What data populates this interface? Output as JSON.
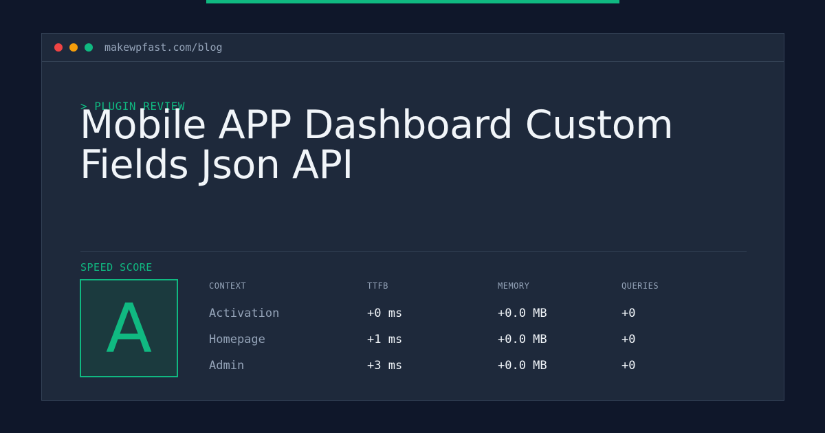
{
  "window": {
    "url": "makewpfast.com/blog"
  },
  "hero": {
    "eyebrow": "> PLUGIN REVIEW",
    "title": "Mobile APP Dashboard Custom Fields Json API"
  },
  "score": {
    "label": "SPEED SCORE",
    "grade": "A"
  },
  "table": {
    "headers": [
      "CONTEXT",
      "TTFB",
      "MEMORY",
      "QUERIES"
    ],
    "rows": [
      {
        "context": "Activation",
        "ttfb": "+0 ms",
        "memory": "+0.0 MB",
        "queries": "+0"
      },
      {
        "context": "Homepage",
        "ttfb": "+1 ms",
        "memory": "+0.0 MB",
        "queries": "+0"
      },
      {
        "context": "Admin",
        "ttfb": "+3 ms",
        "memory": "+0.0 MB",
        "queries": "+0"
      }
    ]
  },
  "colors": {
    "accent": "#10b981",
    "background": "#0f172a",
    "panel": "#1e293b",
    "dot_red": "#ef4444",
    "dot_yellow": "#f59e0b",
    "dot_green": "#10b981"
  }
}
